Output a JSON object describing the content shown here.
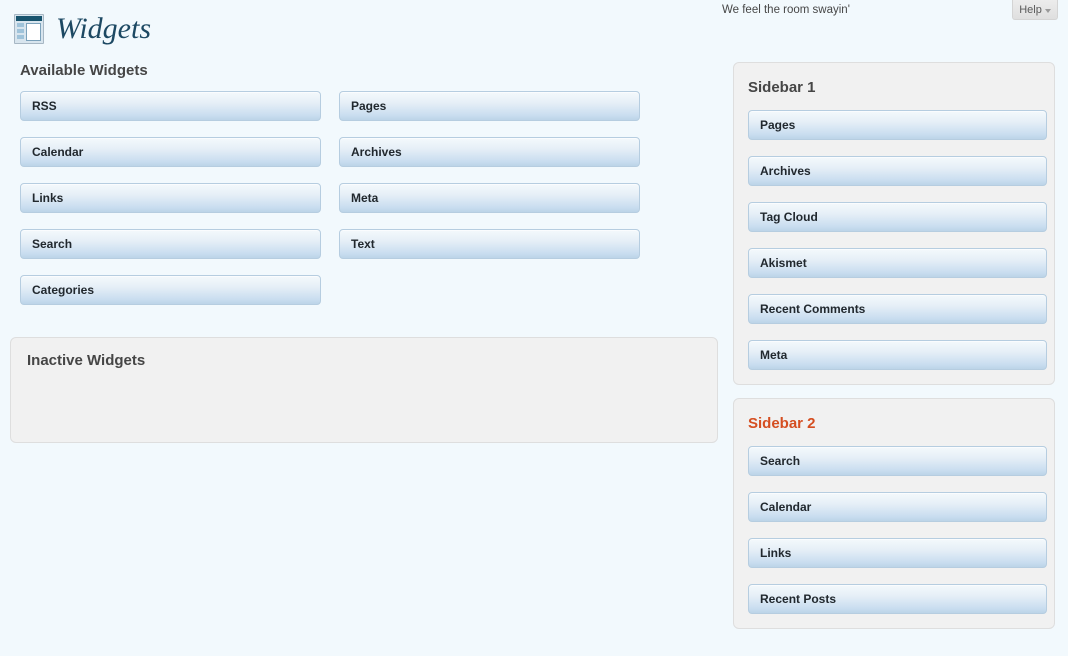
{
  "header": {
    "title": "Widgets",
    "icon": "widgets-window-icon",
    "tagline": "We feel the room swayin'",
    "help_label": "Help"
  },
  "available": {
    "heading": "Available Widgets",
    "columns": [
      [
        "RSS",
        "Calendar",
        "Links",
        "Search",
        "Categories"
      ],
      [
        "Pages",
        "Archives",
        "Meta",
        "Text"
      ]
    ],
    "items_in_order": [
      "RSS",
      "Pages",
      "Calendar",
      "Archives",
      "Links",
      "Meta",
      "Search",
      "Text",
      "Categories"
    ]
  },
  "inactive": {
    "heading": "Inactive Widgets",
    "items": []
  },
  "sidebars": [
    {
      "heading": "Sidebar 1",
      "accent": false,
      "items": [
        "Pages",
        "Archives",
        "Tag Cloud",
        "Akismet",
        "Recent Comments",
        "Meta"
      ]
    },
    {
      "heading": "Sidebar 2",
      "accent": true,
      "items": [
        "Search",
        "Calendar",
        "Links",
        "Recent Posts"
      ]
    }
  ],
  "colors": {
    "page_background": "#f2f9fd",
    "panel_background": "#f1f1f1",
    "panel_border": "#dedede",
    "heading_text": "#464646",
    "accent_heading": "#d54e21",
    "title_text": "#1d4963",
    "chip_gradient_top": "#f4f9fc",
    "chip_gradient_bottom": "#bcd4e8",
    "chip_border": "#b6cde0"
  }
}
